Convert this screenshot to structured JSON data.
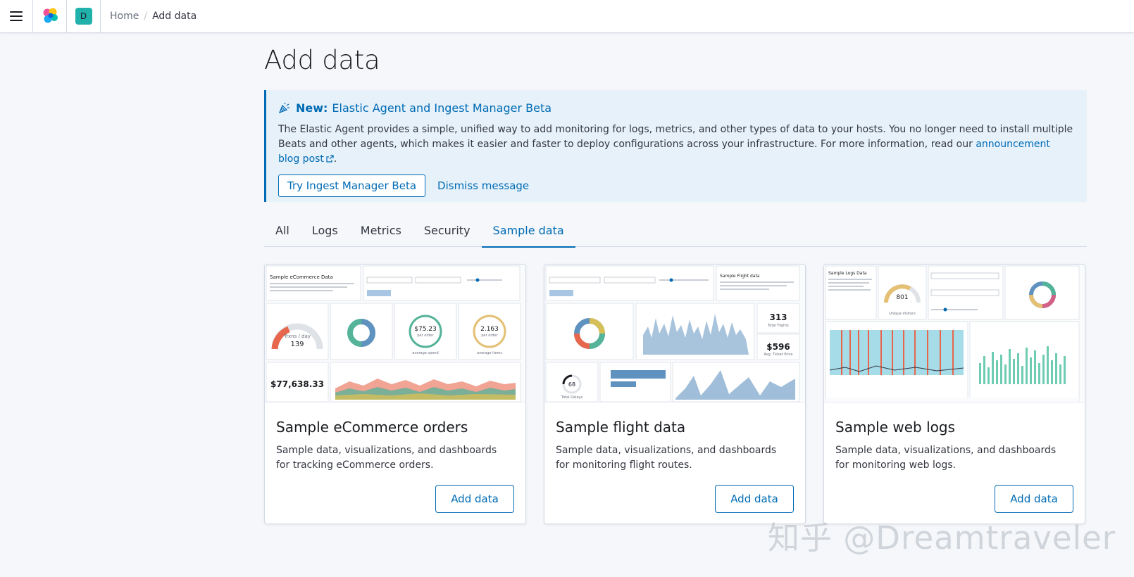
{
  "header": {
    "space_initial": "D",
    "breadcrumbs": {
      "home": "Home",
      "separator": "/",
      "current": "Add data"
    },
    "icons": {
      "menu": "hamburger-icon",
      "logo": "elastic-logo-icon"
    },
    "colors": {
      "space_avatar": "#20b2aa"
    }
  },
  "page": {
    "title": "Add data"
  },
  "callout": {
    "icon": "cheer-icon",
    "title_strong": "New:",
    "title_text": "Elastic Agent and Ingest Manager Beta",
    "body": "The Elastic Agent provides a simple, unified way to add monitoring for logs, metrics, and other types of data to your hosts. You no longer need to install multiple Beats and other agents, which makes it easier and faster to deploy configurations across your infrastructure. For more information, read our ",
    "link_text": "announcement blog post",
    "body_end": ".",
    "primary_button": "Try Ingest Manager Beta",
    "secondary_button": "Dismiss message",
    "colors": {
      "background": "#e6f1fa",
      "accent": "#006bb4"
    }
  },
  "tabs": [
    {
      "label": "All",
      "active": false
    },
    {
      "label": "Logs",
      "active": false
    },
    {
      "label": "Metrics",
      "active": false
    },
    {
      "label": "Security",
      "active": false
    },
    {
      "label": "Sample data",
      "active": true
    }
  ],
  "cards": [
    {
      "title": "Sample eCommerce orders",
      "description": "Sample data, visualizations, and dashboards for tracking eCommerce orders.",
      "button": "Add data",
      "preview": {
        "heading": "Sample eCommerce Data",
        "gauge_label": "Trxns / day",
        "gauge_value": "139",
        "spend_value": "$75.23",
        "spend_sub": "per order",
        "spend_label": "average spend",
        "items_value": "2.163",
        "items_sub": "per order",
        "items_label": "average items",
        "revenue": "$77,638.33"
      }
    },
    {
      "title": "Sample flight data",
      "description": "Sample data, visualizations, and dashboards for monitoring flight routes.",
      "button": "Add data",
      "preview": {
        "heading": "Sample Flight data",
        "total_flights": "313",
        "total_flights_label": "Total Flights",
        "ticket_price": "$596",
        "ticket_price_label": "Avg. Ticket Price",
        "delays_value": "68",
        "delays_label": "Total Delays"
      }
    },
    {
      "title": "Sample web logs",
      "description": "Sample data, visualizations, and dashboards for monitoring web logs.",
      "button": "Add data",
      "preview": {
        "heading": "Sample Logs Data",
        "visitors_value": "801",
        "visitors_label": "Unique Visitors"
      }
    }
  ],
  "watermark": "知乎 @Dreamtraveler"
}
